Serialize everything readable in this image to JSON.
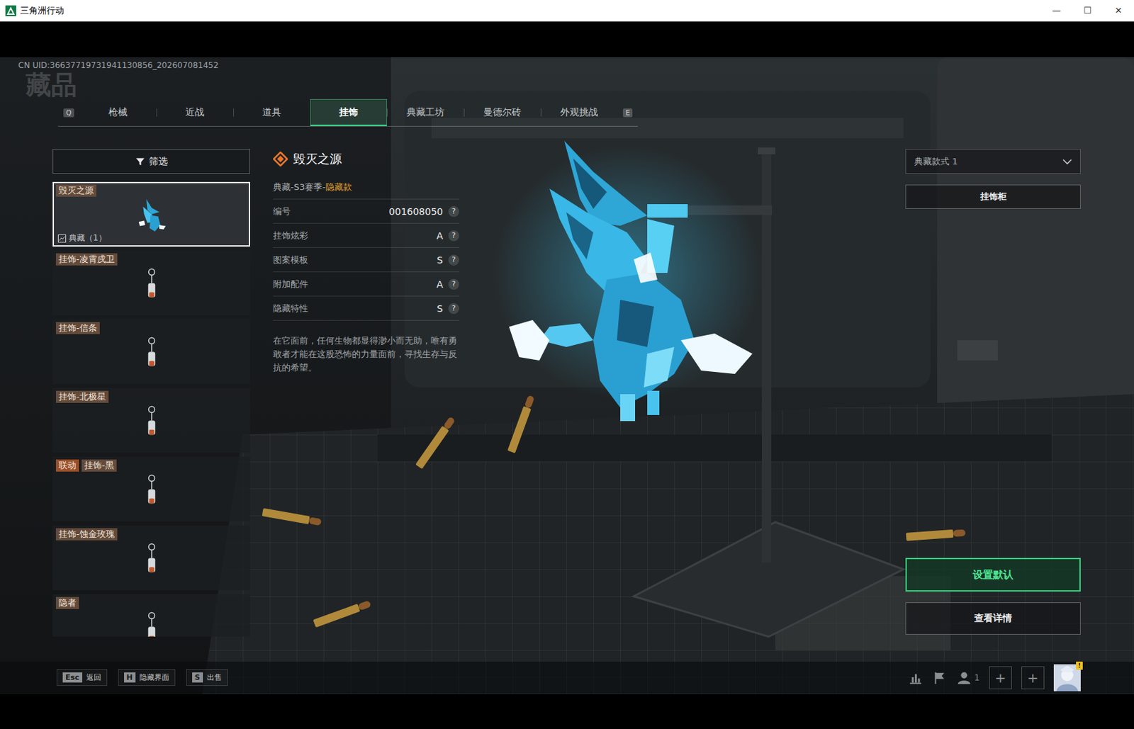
{
  "window": {
    "title": "三角洲行动",
    "controls": [
      "—",
      "☐",
      "✕"
    ]
  },
  "uid": "CN UID:36637719731941130856_202607081452",
  "page_title": "藏品",
  "tab_keys": {
    "prev": "Q",
    "next": "E"
  },
  "tabs": [
    {
      "label": "枪械",
      "selected": false
    },
    {
      "label": "近战",
      "selected": false
    },
    {
      "label": "道具",
      "selected": false
    },
    {
      "label": "挂饰",
      "selected": true
    },
    {
      "label": "典藏工坊",
      "selected": false
    },
    {
      "label": "曼德尔砖",
      "selected": false
    },
    {
      "label": "外观挑战",
      "selected": false
    }
  ],
  "filter": {
    "label": "筛选"
  },
  "items": [
    {
      "name": "毁灭之源",
      "count": "典藏（1）",
      "selected": true
    },
    {
      "name": "挂饰-凌霄戍卫",
      "selected": false
    },
    {
      "name": "挂饰-信条",
      "selected": false
    },
    {
      "name": "挂饰-北极星",
      "selected": false
    },
    {
      "tag": "联动",
      "name": "挂饰-黑",
      "selected": false
    },
    {
      "name": "挂饰-蚀金玫瑰",
      "selected": false
    },
    {
      "name": "隐者",
      "selected": false
    }
  ],
  "detail": {
    "title": "毁灭之源",
    "series": "典藏-S3赛季-",
    "rarity": "隐藏款",
    "stats": [
      {
        "label": "编号",
        "value": "001608050",
        "help": "?"
      },
      {
        "label": "挂饰炫彩",
        "value": "A",
        "help": "?"
      },
      {
        "label": "图案模板",
        "value": "S",
        "help": "?"
      },
      {
        "label": "附加配件",
        "value": "A",
        "help": "?"
      },
      {
        "label": "隐藏特性",
        "value": "S",
        "help": "?"
      }
    ],
    "description": "在它面前，任何生物都显得渺小而无助，唯有勇敢者才能在这股恐怖的力量面前，寻找生存与反抗的希望。"
  },
  "style_select": {
    "value": "典藏款式 1"
  },
  "cabinet_button": "挂饰柜",
  "actions": [
    {
      "label": "设置默认",
      "kind": "primary"
    },
    {
      "label": "查看详情",
      "kind": "outline"
    }
  ],
  "hotkeys": [
    {
      "key": "Esc",
      "label": "返回"
    },
    {
      "key": "H",
      "label": "隐藏界面"
    },
    {
      "key": "S",
      "label": "出售"
    }
  ],
  "status": {
    "party_count": "1",
    "add_slots": [
      "+",
      "+"
    ],
    "avatar_badge": "!"
  }
}
